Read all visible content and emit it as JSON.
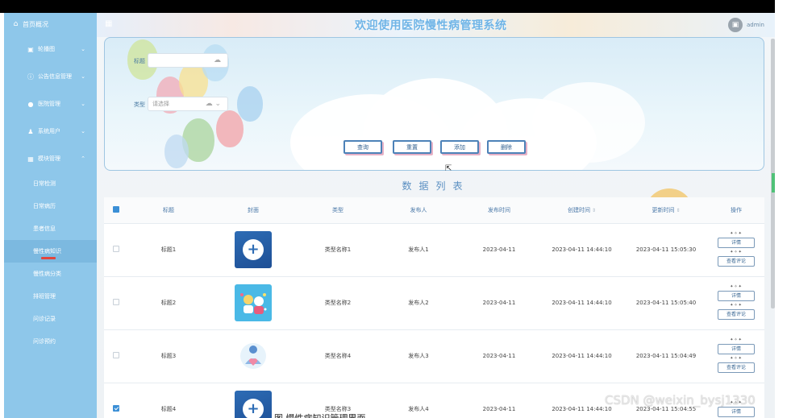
{
  "header": {
    "title": "欢迎使用医院慢性病管理系统",
    "user": "admin"
  },
  "sidebar": {
    "home": "首页概况",
    "groups": [
      {
        "label": "轮播图",
        "icon": "image-icon"
      },
      {
        "label": "公告信息管理",
        "icon": "info-icon"
      },
      {
        "label": "医院管理",
        "icon": "location-icon"
      },
      {
        "label": "系统用户",
        "icon": "user-icon"
      },
      {
        "label": "模块管理",
        "icon": "grid-icon"
      }
    ],
    "subitems": [
      "日常检测",
      "日常病历",
      "患者信息",
      "慢性病知识",
      "慢性病分类",
      "排班管理",
      "问诊记录",
      "问诊预约"
    ],
    "active_index": 3
  },
  "search": {
    "title_label": "标题",
    "type_label": "类型",
    "type_placeholder": "请选择",
    "buttons": [
      "查询",
      "重置",
      "添加",
      "删除"
    ]
  },
  "list_title": "数据列表",
  "table": {
    "headers": [
      "标题",
      "封面",
      "类型",
      "发布人",
      "发布时间",
      "创建时间",
      "更新时间",
      "操作"
    ],
    "rows": [
      {
        "title": "标题1",
        "type": "类型名称1",
        "publisher": "发布人1",
        "publish_date": "2023-04-11",
        "created": "2023-04-11 14:44:10",
        "updated": "2023-04-11 15:05:30",
        "checked": false,
        "cover": "medical-cross-hand"
      },
      {
        "title": "标题2",
        "type": "类型名称2",
        "publisher": "发布人2",
        "publish_date": "2023-04-11",
        "created": "2023-04-11 14:44:10",
        "updated": "2023-04-11 15:05:40",
        "checked": false,
        "cover": "cartoon-doctors"
      },
      {
        "title": "标题3",
        "type": "类型名称4",
        "publisher": "发布人3",
        "publish_date": "2023-04-11",
        "created": "2023-04-11 14:44:10",
        "updated": "2023-04-11 15:04:49",
        "checked": false,
        "cover": "doctor-heart"
      },
      {
        "title": "标题4",
        "type": "类型名称3",
        "publisher": "发布人4",
        "publish_date": "2023-04-11",
        "created": "2023-04-11 14:44:10",
        "updated": "2023-04-11 15:04:55",
        "checked": true,
        "cover": "medical-cross-hand"
      }
    ],
    "op_detail": "详情",
    "op_comment": "查看评论"
  },
  "watermark": "CSDN @weixin_bysj1330",
  "caption": "图  慢性病知识管理界面"
}
